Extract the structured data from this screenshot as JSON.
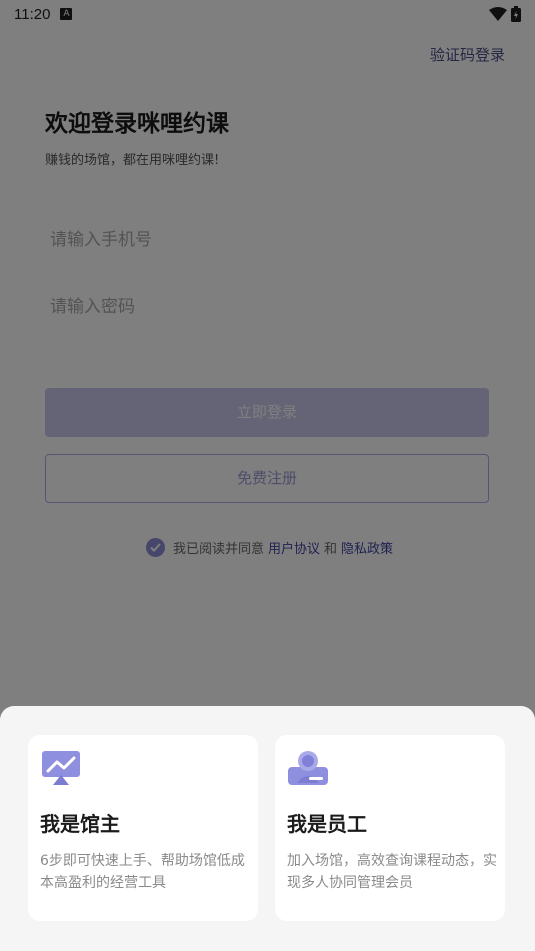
{
  "status_bar": {
    "time": "11:20"
  },
  "top_link": "验证码登录",
  "title": "欢迎登录咪哩约课",
  "subtitle": "赚钱的场馆，都在用咪哩约课!",
  "phone_field": {
    "placeholder": "请输入手机号",
    "value": ""
  },
  "password_field": {
    "placeholder": "请输入密码",
    "value": ""
  },
  "login_button": "立即登录",
  "register_button": "免费注册",
  "agreement": {
    "prefix": "我已阅读并同意",
    "user_agreement": "用户协议",
    "and": "和",
    "privacy_policy": "隐私政策",
    "checked": true
  },
  "sheet": {
    "owner": {
      "title": "我是馆主",
      "desc": "6步即可快速上手、帮助场馆低成本高盈利的经营工具",
      "icon": "chart-monitor-icon"
    },
    "staff": {
      "title": "我是员工",
      "desc": "加入场馆，高效查询课程动态，实现多人协同管理会员",
      "icon": "staff-badge-icon"
    }
  },
  "colors": {
    "accent": "#6b6bd6",
    "link": "#3f44a0",
    "scrim": "rgba(0,0,0,0.5)"
  }
}
